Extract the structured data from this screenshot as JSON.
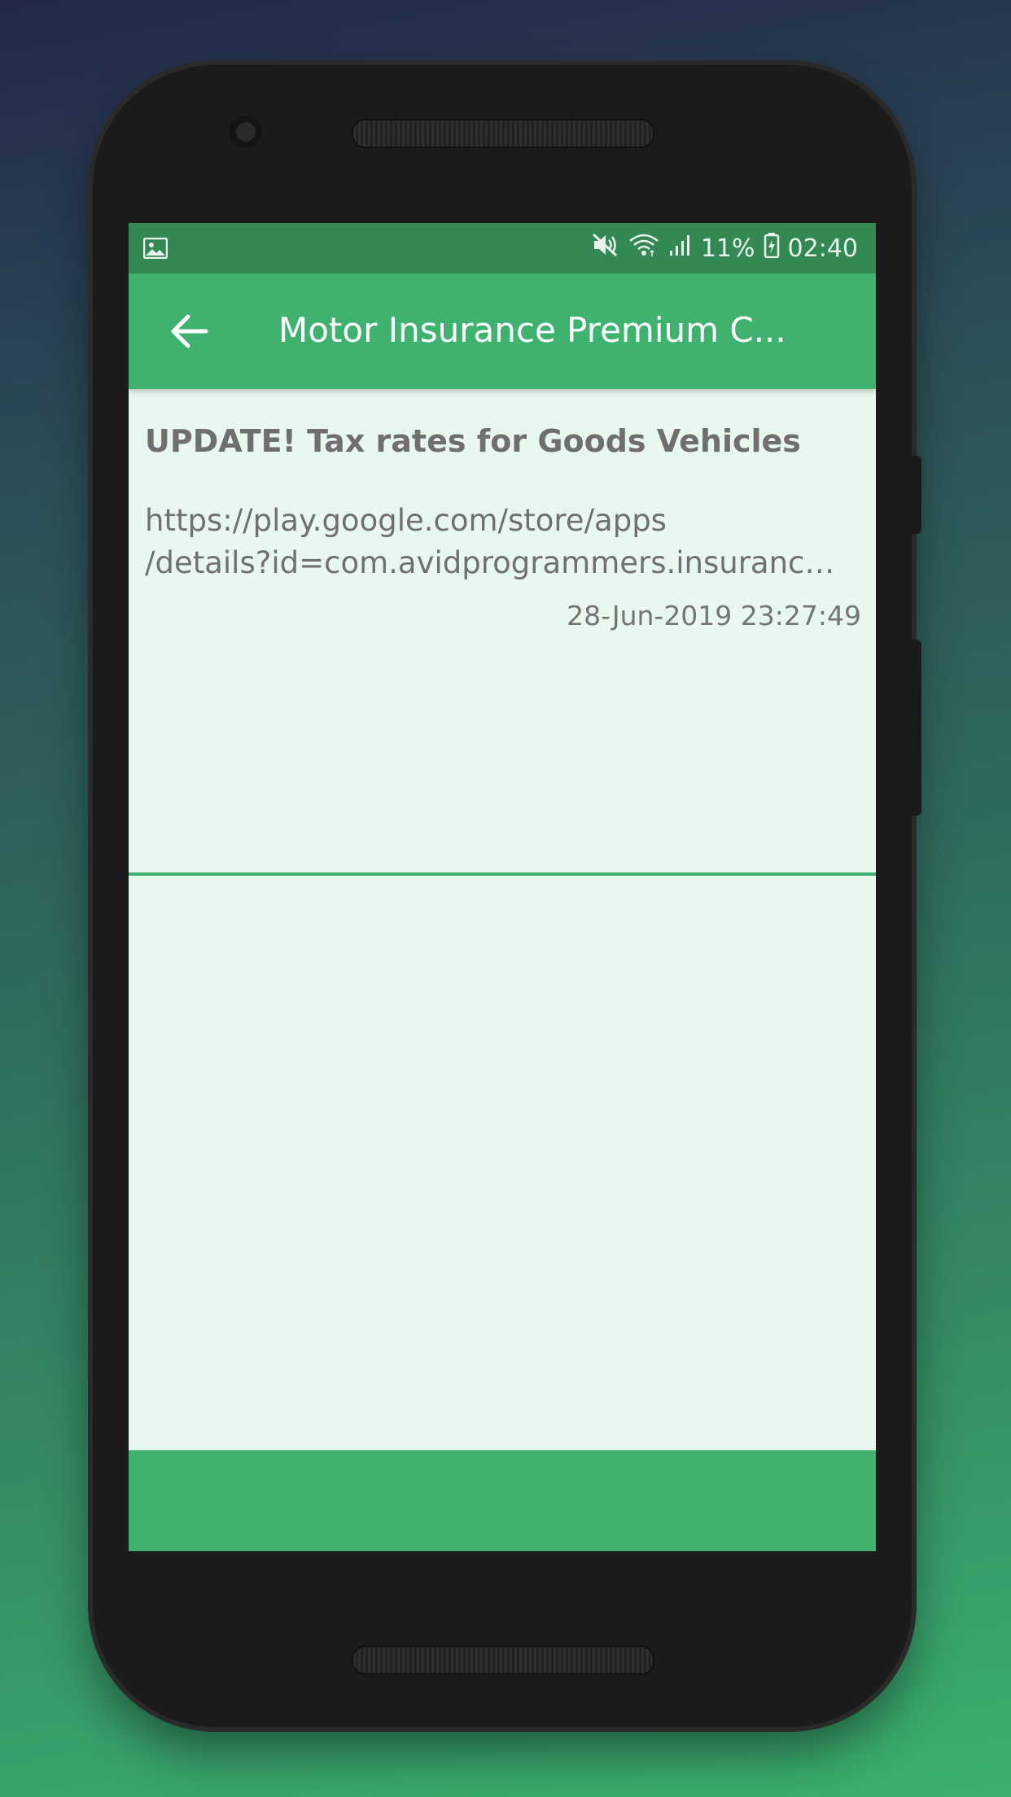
{
  "status_bar": {
    "battery_percent": "11%",
    "time": "02:40",
    "icons": [
      "image-icon",
      "mute-icon",
      "wifi-icon",
      "signal-icon",
      "battery-icon"
    ]
  },
  "app_bar": {
    "title": "Motor Insurance Premium C...",
    "back_icon": "arrow-left-icon"
  },
  "notifications": [
    {
      "title": "UPDATE! Tax rates for Goods Vehicles",
      "body_line1": "https://play.google.com/store/apps",
      "body_line2": "/details?id=com.avidprogrammers.insurancep...",
      "date": "28-Jun-2019 23:27:49"
    }
  ],
  "colors": {
    "primary": "#3eb26e",
    "primary_dark": "#338853",
    "screen_background": "#e9f8ef",
    "text": "#707070"
  }
}
